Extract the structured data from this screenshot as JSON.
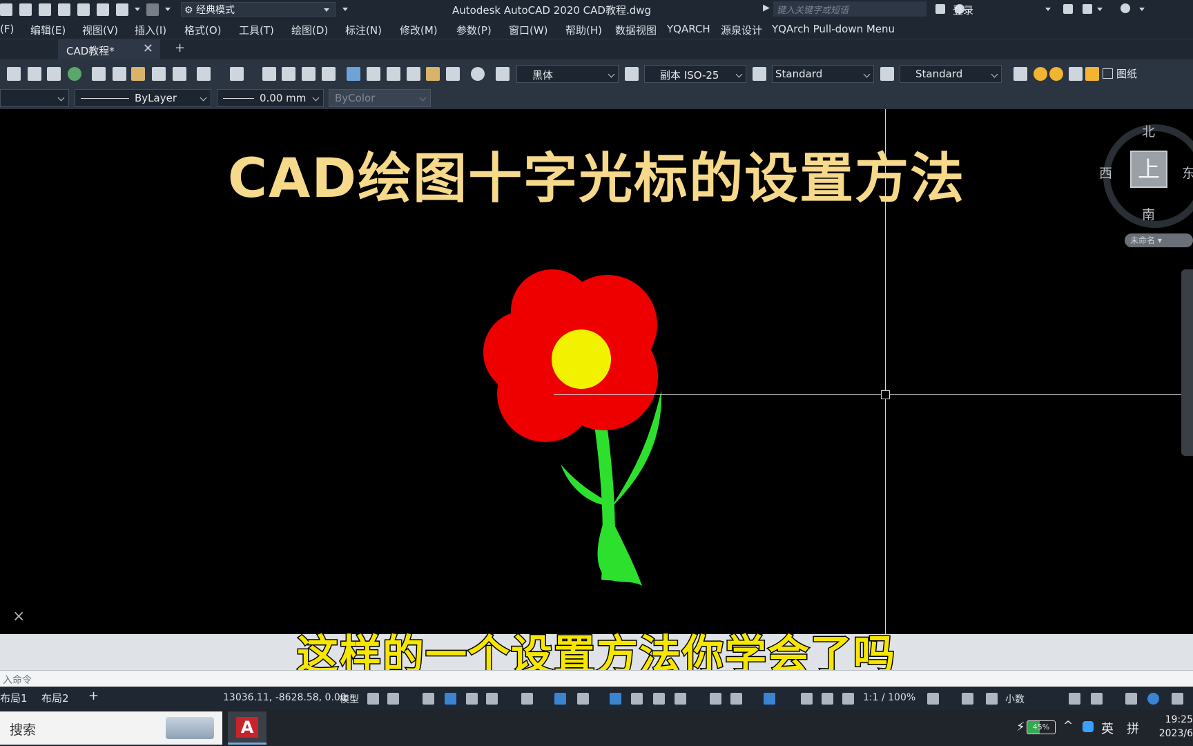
{
  "titlebar": {
    "workspace": "经典模式",
    "app_title": "Autodesk AutoCAD 2020    CAD教程.dwg",
    "search_placeholder": "键入关键字或短语",
    "login": "登录"
  },
  "menu": [
    "(F)",
    "编辑(E)",
    "视图(V)",
    "插入(I)",
    "格式(O)",
    "工具(T)",
    "绘图(D)",
    "标注(N)",
    "修改(M)",
    "参数(P)",
    "窗口(W)",
    "帮助(H)",
    "数据视图",
    "YQARCH",
    "源泉设计",
    "YQArch Pull-down Menu"
  ],
  "tabs": {
    "active": "CAD教程*",
    "new": "+"
  },
  "toolbar1": {
    "font_style": "黑体",
    "dim_style": "副本 ISO-25",
    "table_style": "Standard",
    "multileader_style": "Standard",
    "paper_label": "图纸"
  },
  "toolbar2": {
    "linetype": "ByLayer",
    "lineweight": "0.00 mm",
    "plot_style": "ByColor"
  },
  "drawing": {
    "video_title": "CAD绘图十字光标的设置方法",
    "subtitle": "这样的一个设置方法你学会了吗"
  },
  "viewcube": {
    "north": "北",
    "south": "南",
    "west": "西",
    "east": "东",
    "face": "上",
    "wcs": "未命名"
  },
  "command": {
    "prompt": "入命令",
    "close": "×"
  },
  "status": {
    "layouts": [
      "布局1",
      "布局2"
    ],
    "add_layout": "+",
    "coords": "13036.11, -8628.58, 0.00",
    "model": "模型",
    "scale": "1:1 / 100%",
    "units": "小数"
  },
  "taskbar": {
    "search": "搜索",
    "battery": "45%",
    "ime": "英",
    "ime2": "拼",
    "time": "19:25",
    "date": "2023/6"
  }
}
